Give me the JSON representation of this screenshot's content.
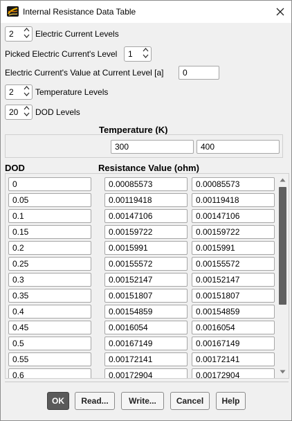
{
  "window": {
    "title": "Internal Resistance Data Table",
    "close_icon": "close-icon"
  },
  "settings": {
    "electric_current_levels": {
      "value": "2",
      "label": "Electric Current Levels"
    },
    "picked_level": {
      "label": "Picked Electric Current's Level",
      "value": "1"
    },
    "current_value": {
      "label": "Electric Current's Value at Current Level [a]",
      "value": "0"
    },
    "temperature_levels": {
      "value": "2",
      "label": "Temperature Levels"
    },
    "dod_levels": {
      "value": "20",
      "label": "DOD Levels"
    }
  },
  "temperature": {
    "header": "Temperature (K)",
    "values": [
      "300",
      "400"
    ]
  },
  "table": {
    "dod_header": "DOD",
    "resistance_header": "Resistance Value (ohm)",
    "rows": [
      {
        "dod": "0",
        "r1": "0.00085573",
        "r2": "0.00085573"
      },
      {
        "dod": "0.05",
        "r1": "0.00119418",
        "r2": "0.00119418"
      },
      {
        "dod": "0.1",
        "r1": "0.00147106",
        "r2": "0.00147106"
      },
      {
        "dod": "0.15",
        "r1": "0.00159722",
        "r2": "0.00159722"
      },
      {
        "dod": "0.2",
        "r1": "0.0015991",
        "r2": "0.0015991"
      },
      {
        "dod": "0.25",
        "r1": "0.00155572",
        "r2": "0.00155572"
      },
      {
        "dod": "0.3",
        "r1": "0.00152147",
        "r2": "0.00152147"
      },
      {
        "dod": "0.35",
        "r1": "0.00151807",
        "r2": "0.00151807"
      },
      {
        "dod": "0.4",
        "r1": "0.00154859",
        "r2": "0.00154859"
      },
      {
        "dod": "0.45",
        "r1": "0.0016054",
        "r2": "0.0016054"
      },
      {
        "dod": "0.5",
        "r1": "0.00167149",
        "r2": "0.00167149"
      },
      {
        "dod": "0.55",
        "r1": "0.00172141",
        "r2": "0.00172141"
      },
      {
        "dod": "0.6",
        "r1": "0.00172904",
        "r2": "0.00172904"
      }
    ]
  },
  "buttons": {
    "ok": "OK",
    "read": "Read...",
    "write": "Write...",
    "cancel": "Cancel",
    "help": "Help"
  },
  "colors": {
    "dialog_bg": "#f0f0f0",
    "primary_button": "#5a5a5a",
    "scroll_thumb": "#606060"
  }
}
